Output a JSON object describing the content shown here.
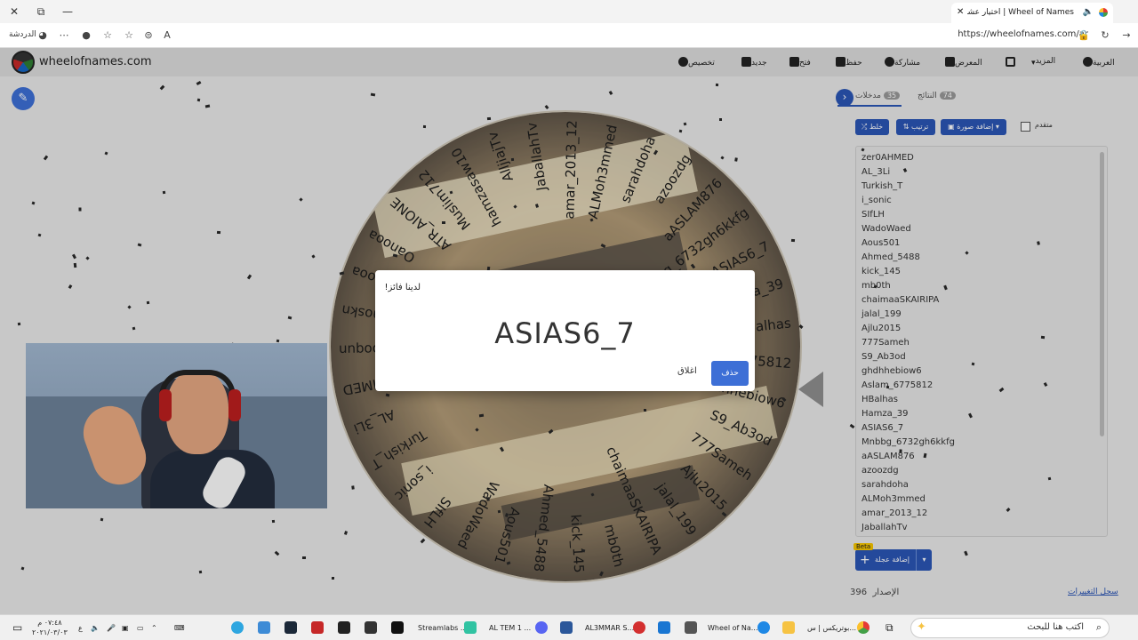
{
  "browser": {
    "tab_title": "Wheel of Names | اختيار عشوائي",
    "window_close": "✕",
    "window_restore": "⧉",
    "window_minimize": "—",
    "new_tab": "+",
    "url": "https://wheelofnames.com/ar",
    "left_label": "الدردشة"
  },
  "app": {
    "site_name": "wheelofnames.com",
    "menu": [
      {
        "label": "تخصيص",
        "icon": "palette-icon"
      },
      {
        "label": "جديد",
        "icon": "new-file-icon"
      },
      {
        "label": "فتح",
        "icon": "folder-icon"
      },
      {
        "label": "حفظ",
        "icon": "save-icon"
      },
      {
        "label": "مشاركة",
        "icon": "share-icon"
      },
      {
        "label": "المعرض",
        "icon": "gallery-icon"
      },
      {
        "label": "",
        "icon": "fullscreen-icon"
      },
      {
        "label": "المزيد",
        "icon": "more-dropdown-icon"
      },
      {
        "label": "العربية",
        "icon": "globe-icon"
      }
    ]
  },
  "panel": {
    "tab_entries": "مدخلات",
    "entries_count": "35",
    "tab_results": "النتائج",
    "results_count": "74",
    "shuffle_label": "خلط",
    "sort_label": "ترتيب",
    "add_image_label": "إضافة صورة",
    "advanced_label": "متقدم",
    "entries": [
      "zer0AHMED",
      "AL_3Li",
      "Turkish_T",
      "i_sonic",
      "SIfLH",
      "WadoWaed",
      "Aous501",
      "Ahmed_5488",
      "kick_145",
      "mb0th",
      "chaimaaSKAIRIPA",
      "jalal_199",
      "Ajlu2015",
      "777Sameh",
      "S9_Ab3od",
      "ghdhhebiow6",
      "Aslam_6775812",
      "HBalhas",
      "Hamza_39",
      "ASIAS6_7",
      "Mnbbg_6732gh6kkfg",
      "aASLAM876",
      "azoozdg",
      "sarahdoha",
      "ALMoh3mmed",
      "amar_2013_12",
      "JaballahTv"
    ],
    "add_button": "إضافة عجلة",
    "beta": "Beta",
    "version_label": "الإصدار",
    "version_number": "396",
    "changelog": "سجل التغييرات"
  },
  "dialog": {
    "title": "لدينا فائز!",
    "winner": "ASIAS6_7",
    "close_label": "اغلاق",
    "remove_label": "حذف"
  },
  "wheel": {
    "labels": [
      "Oanooa",
      "ATR_AIONE",
      "Muslim712",
      "hamzasaw10",
      "AlljiajTv",
      "JaballahTv",
      "amar_2013_12",
      "ALMoh3mmed",
      "sarahdoha",
      "azoozdg",
      "aASLAM876",
      "Mnbbg_6732gh6kkfg",
      "ASIAS6_7",
      "Hamza_39",
      "HBalhas",
      "Aslam_6775812",
      "ghdhhebiow6",
      "S9_Ab3od",
      "777Sameh",
      "Ajlu2015",
      "jalal_199",
      "chaimaaSKAIRIPA",
      "mb0th",
      "kick_145",
      "Ahmed_5488",
      "Aous501",
      "WadoWaed",
      "SIfLH",
      "i_sonic",
      "Turkish_T",
      "AL_3Li",
      "zer0AHMED",
      "Jxooqun",
      "aaoskn",
      "Oanooa"
    ]
  },
  "taskbar": {
    "search_placeholder": "اكتب هنا للبحث",
    "items": [
      "بوتريكس | س...",
      "Wheel of Na...",
      "AL3MMAR S...",
      "AL TEM 1 ...",
      "Streamlabs ..."
    ],
    "time": "٠٧:٤٨ م",
    "date": "٢٠٢١/٠٣/٠٣"
  }
}
